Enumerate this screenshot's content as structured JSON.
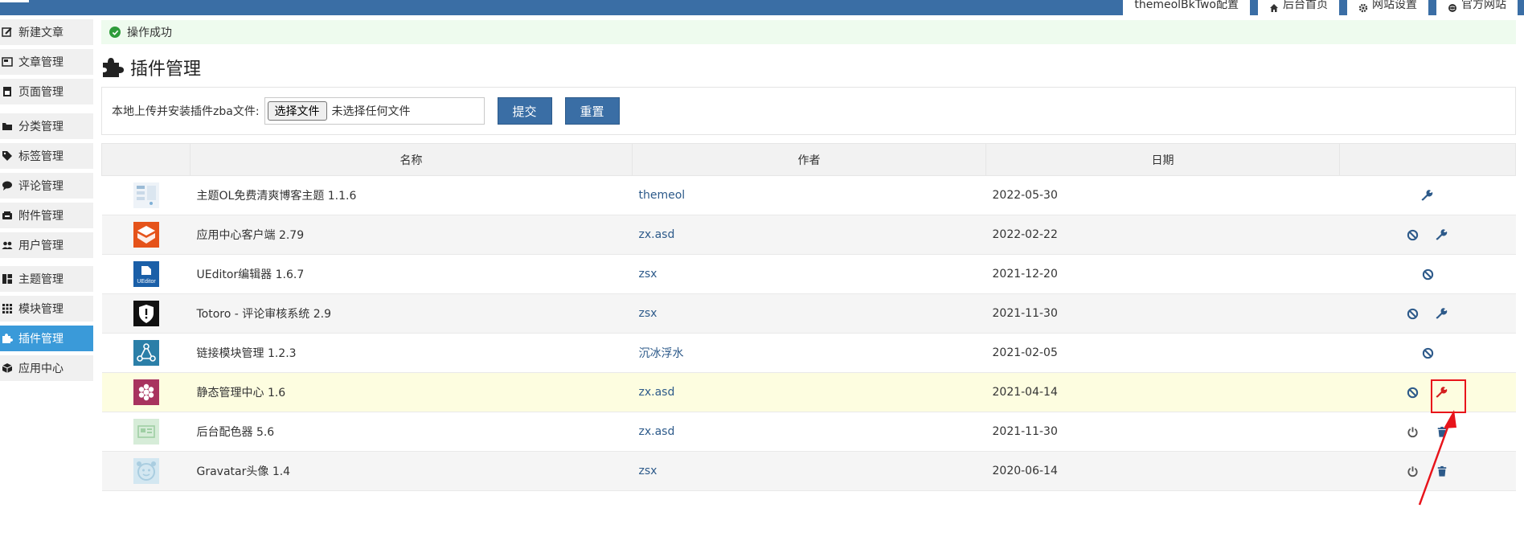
{
  "header": {
    "brand_fragment": "后台首页",
    "tabs": [
      {
        "label": "themeolBkTwo配置",
        "icon": ""
      },
      {
        "label": "后台首页",
        "icon": "home-icon"
      },
      {
        "label": "网站设置",
        "icon": "gear-icon"
      },
      {
        "label": "官方网站",
        "icon": "globe-icon"
      }
    ]
  },
  "sidebar": {
    "items": [
      {
        "label": "新建文章",
        "icon": "edit-icon"
      },
      {
        "label": "文章管理",
        "icon": "article-icon"
      },
      {
        "label": "页面管理",
        "icon": "page-icon"
      },
      {
        "label": "分类管理",
        "icon": "folder-icon"
      },
      {
        "label": "标签管理",
        "icon": "tag-icon"
      },
      {
        "label": "评论管理",
        "icon": "comment-icon"
      },
      {
        "label": "附件管理",
        "icon": "attachment-icon"
      },
      {
        "label": "用户管理",
        "icon": "users-icon"
      },
      {
        "label": "主题管理",
        "icon": "theme-icon"
      },
      {
        "label": "模块管理",
        "icon": "grid-icon"
      },
      {
        "label": "插件管理",
        "icon": "puzzle-icon",
        "active": true
      },
      {
        "label": "应用中心",
        "icon": "box-icon"
      }
    ]
  },
  "alert": {
    "message": "操作成功"
  },
  "page": {
    "title": "插件管理"
  },
  "upload": {
    "label": "本地上传并安装插件zba文件:",
    "file_button": "选择文件",
    "file_status": "未选择任何文件",
    "submit_label": "提交",
    "reset_label": "重置"
  },
  "table": {
    "headers": [
      "",
      "名称",
      "作者",
      "日期",
      ""
    ],
    "rows": [
      {
        "name": "主题OL免费清爽博客主题 1.1.6",
        "author": "themeol",
        "date": "2022-05-30",
        "actions": [
          "wrench"
        ],
        "icon_color": "#e8eef5"
      },
      {
        "name": "应用中心客户端 2.79",
        "author": "zx.asd",
        "date": "2022-02-22",
        "actions": [
          "ban",
          "wrench"
        ],
        "icon_color": "#e5531a"
      },
      {
        "name": "UEditor编辑器 1.6.7",
        "author": "zsx",
        "date": "2021-12-20",
        "actions": [
          "ban"
        ],
        "icon_color": "#1a5fa8",
        "icon_text": "UEditor"
      },
      {
        "name": "Totoro - 评论审核系统 2.9",
        "author": "zsx",
        "date": "2021-11-30",
        "actions": [
          "ban",
          "wrench"
        ],
        "icon_color": "#111111"
      },
      {
        "name": "链接模块管理 1.2.3",
        "author": "沉冰浮水",
        "date": "2021-02-05",
        "actions": [
          "ban"
        ],
        "icon_color": "#2b7fa8"
      },
      {
        "name": "静态管理中心 1.6",
        "author": "zx.asd",
        "date": "2021-04-14",
        "actions": [
          "ban",
          "wrench-red"
        ],
        "icon_color": "#a8335f"
      },
      {
        "name": "后台配色器 5.6",
        "author": "zx.asd",
        "date": "2021-11-30",
        "actions": [
          "power",
          "trash"
        ],
        "icon_color": "#cfe8d2"
      },
      {
        "name": "Gravatar头像 1.4",
        "author": "zsx",
        "date": "2020-06-14",
        "actions": [
          "power",
          "trash"
        ],
        "icon_color": "#cfe3ee"
      }
    ]
  },
  "colors": {
    "accent": "#3a6ea5",
    "active_side": "#3a9ad9",
    "highlight": "#e8141b"
  }
}
